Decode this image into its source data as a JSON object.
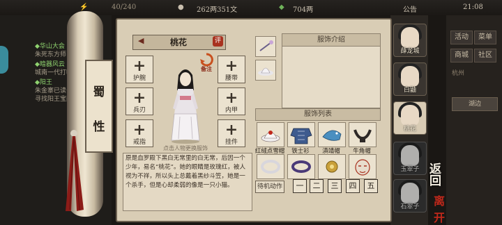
{
  "topbar": {
    "energy": "40/240",
    "money": "262两351文",
    "gold": "704两",
    "notice": "公告",
    "time": "21:08"
  },
  "quest_log": [
    {
      "title": "◆华山大会",
      "sub": "朱死东方师"
    },
    {
      "title": "◆暗器风云",
      "sub": "城南一代打听"
    },
    {
      "title": "◆阳王",
      "sub": "朱金寨已读书"
    },
    {
      "title": "",
      "sub": "寻找阳王宝藏"
    }
  ],
  "scroll": {
    "char1": "蜀",
    "char2": "性"
  },
  "character": {
    "name": "桃花",
    "rate_label": "评",
    "sub_label": "备注",
    "hint": "点击人物更换服饰",
    "description": "原是血罗殿下黑白无常里的白无常，后因一个少年，易名“桃花”。她的眼睛是玫瑰红，被人视为不祥，所以头上总戴着黑纱斗笠，她是一个杀手，但是心却柔弱的像是一只小猫。"
  },
  "slots_left": [
    "护腕",
    "兵刃",
    "戒指"
  ],
  "slots_right": [
    "腰带",
    "内甲",
    "挂件"
  ],
  "clothing_intro_title": "服饰介绍",
  "clothing_list_title": "服饰列表",
  "items": [
    {
      "name": "红绒点雪帽"
    },
    {
      "name": "铁士衫"
    },
    {
      "name": "滇靖帽"
    },
    {
      "name": "牛角帽"
    },
    {
      "name": ""
    },
    {
      "name": ""
    },
    {
      "name": ""
    },
    {
      "name": ""
    }
  ],
  "idle_action": "待机动作",
  "pages": [
    "一",
    "二",
    "三",
    "四",
    "五"
  ],
  "roster": [
    {
      "name": "薛龙城"
    },
    {
      "name": "白鼬"
    },
    {
      "name": "桃花"
    },
    {
      "name": "玉翠子"
    },
    {
      "name": "石翠子"
    }
  ],
  "menu": [
    "活动",
    "菜单",
    "商城",
    "社区"
  ],
  "right_info": {
    "location": "杭州",
    "status": "湖边"
  },
  "back_label": "返回",
  "back_label2": "离开"
}
